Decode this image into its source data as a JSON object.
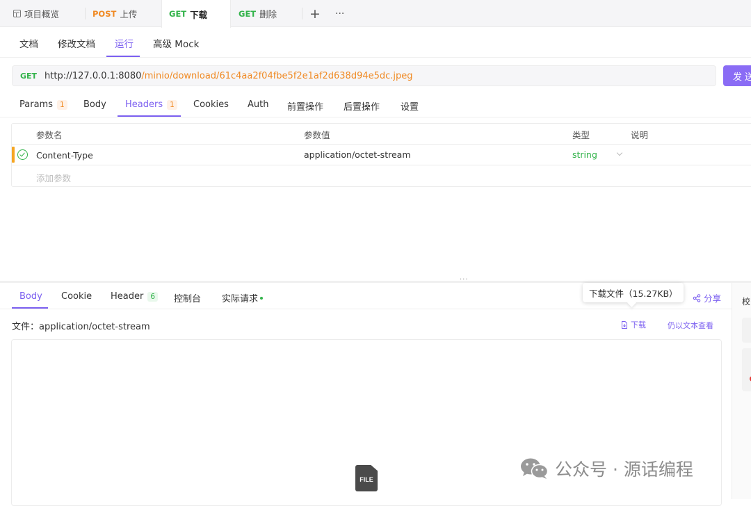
{
  "window_tabs": [
    {
      "label": "项目概览",
      "method": ""
    },
    {
      "label": "上传",
      "method": "POST"
    },
    {
      "label": "下载",
      "method": "GET"
    },
    {
      "label": "删除",
      "method": "GET"
    }
  ],
  "tab_actions": {
    "add": "+",
    "more": "···"
  },
  "doc_tabs": [
    "文档",
    "修改文档",
    "运行",
    "高级 Mock"
  ],
  "request": {
    "method": "GET",
    "url_base": "http://127.0.0.1:8080",
    "url_path": "/minio/download/61c4aa2f04fbe5f2e1af2d638d94e5dc.jpeg",
    "send_label": "发送"
  },
  "request_tabs": [
    {
      "label": "Params",
      "badge": "1"
    },
    {
      "label": "Body",
      "badge": ""
    },
    {
      "label": "Headers",
      "badge": "1"
    },
    {
      "label": "Cookies",
      "badge": ""
    },
    {
      "label": "Auth",
      "badge": ""
    },
    {
      "label": "前置操作",
      "badge": ""
    },
    {
      "label": "后置操作",
      "badge": ""
    },
    {
      "label": "设置",
      "badge": ""
    }
  ],
  "headers_table": {
    "columns": [
      "参数名",
      "参数值",
      "类型",
      "说明"
    ],
    "rows": [
      {
        "name": "Content-Type",
        "value": "application/octet-stream",
        "type": "string"
      }
    ],
    "add_placeholder": "添加参数"
  },
  "response_tabs": [
    {
      "label": "Body",
      "badge": ""
    },
    {
      "label": "Cookie",
      "badge": ""
    },
    {
      "label": "Header",
      "badge": "6"
    },
    {
      "label": "控制台",
      "badge": ""
    },
    {
      "label": "实际请求",
      "badge": ""
    }
  ],
  "tooltip": "下载文件（15.27KB）",
  "share_label": "分享",
  "file_type": "文件：application/octet-stream",
  "download_label": "下载",
  "view_text_label": "仍以文本查看",
  "file_icon_label": "FILE",
  "right_panel_label": "校",
  "watermark": "公众号 · 源话编程",
  "colors": {
    "accent": "#7b5ff0",
    "get": "#32b34a",
    "post": "#f08a24",
    "path": "#f08a24"
  }
}
